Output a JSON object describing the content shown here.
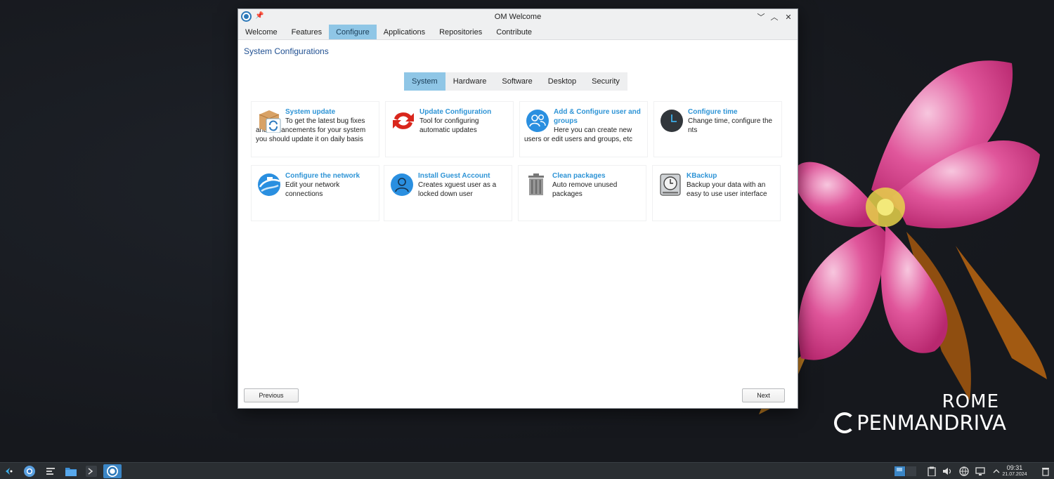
{
  "window": {
    "title": "OM Welcome",
    "controls": {
      "minimize": "﹀",
      "maximize": "︿",
      "close": "✕"
    }
  },
  "menu": {
    "tabs": [
      {
        "label": "Welcome"
      },
      {
        "label": "Features"
      },
      {
        "label": "Configure",
        "active": true
      },
      {
        "label": "Applications"
      },
      {
        "label": "Repositories"
      },
      {
        "label": "Contribute"
      }
    ]
  },
  "page": {
    "title": "System Configurations"
  },
  "subtabs": [
    {
      "label": "System",
      "active": true
    },
    {
      "label": "Hardware"
    },
    {
      "label": "Software"
    },
    {
      "label": "Desktop"
    },
    {
      "label": "Security"
    }
  ],
  "items": [
    {
      "title": "System update",
      "description": "To get the latest bug fixes and enhancements for your system you should update it on daily basis",
      "icon": "package-update-icon"
    },
    {
      "title": "Update Configuration",
      "description": "Tool for configuring automatic updates",
      "icon": "update-config-icon"
    },
    {
      "title": "Add & Configure user and groups",
      "description": "Here you can create new users or edit users and groups, etc",
      "icon": "users-icon"
    },
    {
      "title": "Configure time",
      "description": "Change time, configure the nts",
      "icon": "clock-icon"
    },
    {
      "title": "Configure the network",
      "description": "Edit your network connections",
      "icon": "network-icon"
    },
    {
      "title": "Install Guest Account",
      "description": "Creates xguest user as a locked down user",
      "icon": "guest-user-icon"
    },
    {
      "title": "Clean packages",
      "description": "Auto remove unused packages",
      "icon": "trash-icon"
    },
    {
      "title": "KBackup",
      "description": "Backup your data with an easy to use user interface",
      "icon": "backup-icon"
    }
  ],
  "buttons": {
    "previous": "Previous",
    "next": "Next"
  },
  "branding": {
    "line1": "ROME",
    "line2": "PENMANDRIVA"
  },
  "taskbar": {
    "time": "09:31",
    "date": "21.07.2024"
  },
  "colors": {
    "accent": "#8fc6e6",
    "link": "#2e94d6",
    "title": "#1f4f91"
  }
}
